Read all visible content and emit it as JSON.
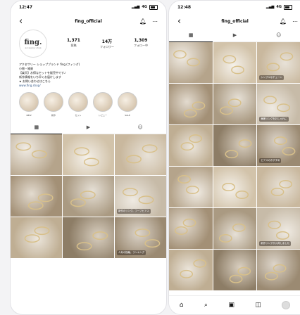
{
  "phone1": {
    "time": "12:47",
    "signal": "4G",
    "username": "fing_official",
    "logo_text": "fing.",
    "logo_sub": "accessory shop",
    "stats": [
      {
        "num": "1,371",
        "label": "投稿"
      },
      {
        "num": "14万",
        "label": "フォロワー"
      },
      {
        "num": "1,309",
        "label": "フォロー中"
      }
    ],
    "bio": [
      "アクセサリー ショップブランド fing.(フィング)",
      "小物・雑貨",
      "【楽天】お得なセットを販売中です♪",
      "新作情報をいち早くお届けします",
      "★ お問い合わせはこちら",
      "www.fing.shop/"
    ],
    "highlights": [
      "NEW",
      "新作",
      "セット",
      "レビュー",
      "SALE"
    ],
    "tabs": [
      "grid",
      "reels",
      "tagged"
    ],
    "captions": [
      "新作のリング。フープピアス",
      "人気の指輪。ランキング",
      "小さめリング"
    ]
  },
  "phone2": {
    "time": "12:48",
    "signal": "4G",
    "username": "fing_official",
    "captions": [
      "シンプルなチェーン",
      "華奢リングをおしゃれに",
      "ピアスのおすすめ",
      "新作リングが入荷しました"
    ],
    "nav": [
      "home",
      "search",
      "reels",
      "shop",
      "profile"
    ]
  }
}
